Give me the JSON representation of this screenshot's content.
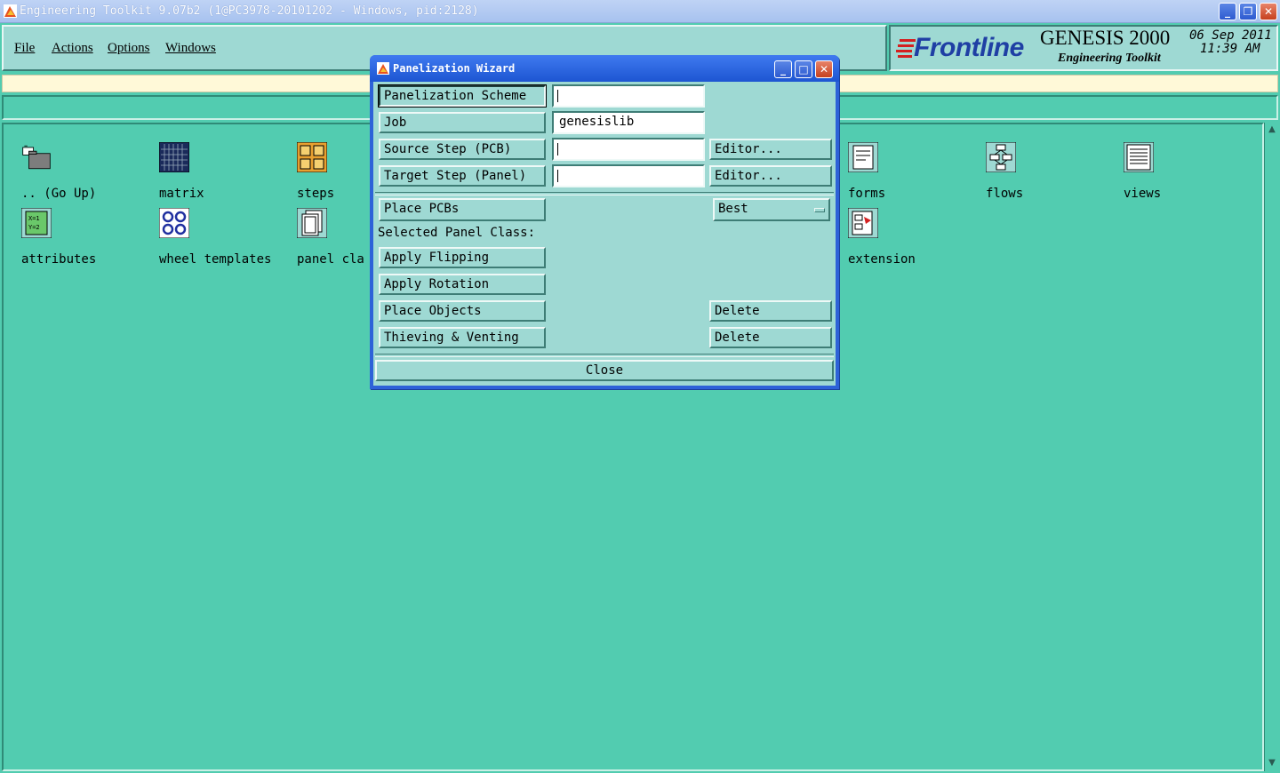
{
  "window": {
    "title": "Engineering Toolkit 9.07b2 (1@PC3978-20101202 - Windows, pid:2128)",
    "buttons": {
      "minimize": "_",
      "maximize": "❐",
      "close": "✕"
    }
  },
  "menubar": {
    "items": [
      {
        "label": "File"
      },
      {
        "label": "Actions"
      },
      {
        "label": "Options"
      },
      {
        "label": "Windows"
      }
    ]
  },
  "branding": {
    "logo": "Frontline",
    "product": "GENESIS 2000",
    "subtitle": "Engineering Toolkit",
    "date": "06 Sep 2011",
    "time": "11:39 AM",
    "logo_color": "#1f3fa4",
    "logo_accent": "#d42020"
  },
  "icons": [
    {
      "label": ".. (Go Up)",
      "icon": "folder-up-icon"
    },
    {
      "label": "matrix",
      "icon": "matrix-icon"
    },
    {
      "label": "steps",
      "icon": "steps-icon"
    },
    {
      "label": "forms",
      "icon": "forms-icon"
    },
    {
      "label": "flows",
      "icon": "flows-icon"
    },
    {
      "label": "views",
      "icon": "views-icon"
    },
    {
      "label": "attributes",
      "icon": "attributes-icon"
    },
    {
      "label": "wheel templates",
      "icon": "wheel-templates-icon"
    },
    {
      "label": "panel cla",
      "icon": "panel-classes-icon"
    },
    {
      "label": "extension",
      "icon": "extension-icon"
    }
  ],
  "dialog": {
    "title": "Panelization Wizard",
    "rows": {
      "scheme": {
        "label": "Panelization Scheme",
        "value": ""
      },
      "job": {
        "label": "Job",
        "value": "genesislib"
      },
      "source": {
        "label": "Source Step (PCB)",
        "value": "",
        "editor": "Editor..."
      },
      "target": {
        "label": "Target Step (Panel)",
        "value": "",
        "editor": "Editor..."
      }
    },
    "place_pcbs": "Place PCBs",
    "placement_option": "Best",
    "selected_panel_class": "Selected Panel Class:",
    "apply_flipping": "Apply Flipping",
    "apply_rotation": "Apply Rotation",
    "place_objects": "Place Objects",
    "thieving_venting": "Thieving & Venting",
    "delete": "Delete",
    "close": "Close"
  },
  "colors": {
    "desktop": "#52ccb0",
    "panel": "#9ed9d3",
    "message_bar": "#fff9d8",
    "dialog_frame": "#2d62d8"
  }
}
